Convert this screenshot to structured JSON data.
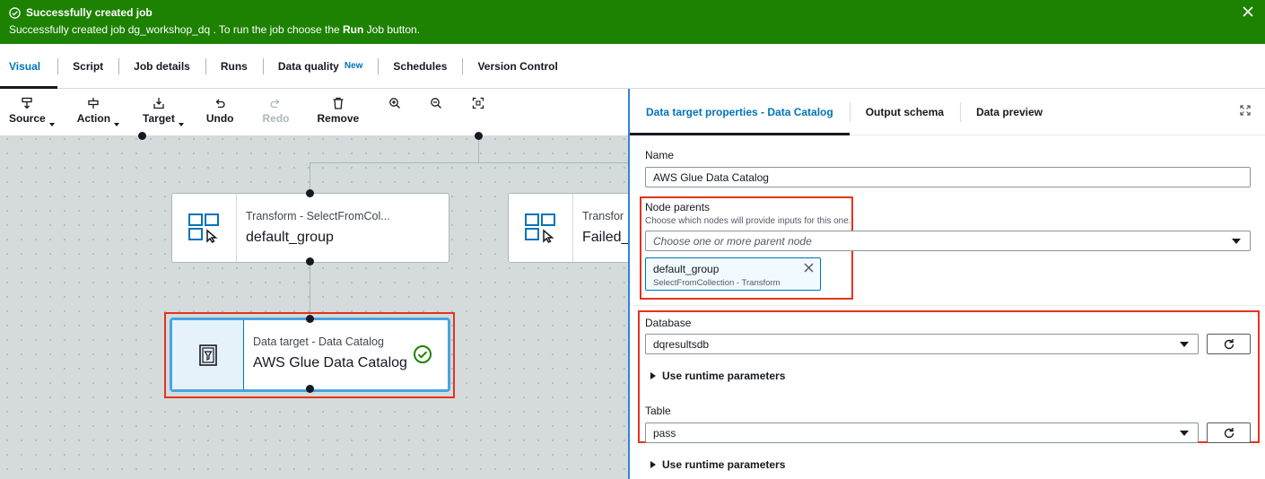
{
  "flash": {
    "title": "Successfully created job",
    "message_prefix": "Successfully created job dg_workshop_dq . To run the job choose the ",
    "message_bold": "Run",
    "message_suffix": " Job button.",
    "color": "#1d8102"
  },
  "tabs": [
    {
      "label": "Visual",
      "active": true
    },
    {
      "label": "Script"
    },
    {
      "label": "Job details"
    },
    {
      "label": "Runs"
    },
    {
      "label": "Data quality",
      "badge": "New"
    },
    {
      "label": "Schedules"
    },
    {
      "label": "Version Control"
    }
  ],
  "toolbar": {
    "source": "Source",
    "action": "Action",
    "target": "Target",
    "undo": "Undo",
    "redo": "Redo",
    "remove": "Remove",
    "icons": [
      "source-icon",
      "action-icon",
      "target-icon",
      "undo-icon",
      "redo-icon",
      "trash-icon",
      "zoom-in-icon",
      "zoom-out-icon",
      "fit-screen-icon"
    ]
  },
  "nodes": {
    "transform1": {
      "type": "Transform - SelectFromCol...",
      "name": "default_group"
    },
    "transform2": {
      "type": "Transfor",
      "name": "Failed_"
    },
    "target": {
      "type": "Data target - Data Catalog",
      "name": "AWS Glue Data Catalog",
      "status": "valid"
    }
  },
  "panel": {
    "tabs": [
      "Data target properties - Data Catalog",
      "Output schema",
      "Data preview"
    ],
    "name_label": "Name",
    "name_value": "AWS Glue Data Catalog",
    "parents_label": "Node parents",
    "parents_hint": "Choose which nodes will provide inputs for this one.",
    "parents_placeholder": "Choose one or more parent node",
    "parent_token": {
      "name": "default_group",
      "detail": "SelectFromCollection - Transform"
    },
    "database_label": "Database",
    "database_value": "dqresultsdb",
    "runtime_label": "Use runtime parameters",
    "table_label": "Table",
    "table_value": "pass"
  },
  "colors": {
    "accent": "#0073bb",
    "highlight": "#e3341e",
    "success": "#1d8102"
  }
}
